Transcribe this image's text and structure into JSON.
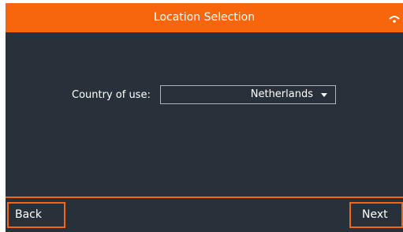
{
  "header": {
    "title": "Location Selection",
    "status_icon": "wifi-icon"
  },
  "main": {
    "country_label": "Country of use:",
    "country_selected": "Netherlands",
    "dropdown_icon": "chevron-down-icon"
  },
  "footer": {
    "back_label": "Back",
    "next_label": "Next"
  },
  "colors": {
    "accent": "#f7660d",
    "background": "#28313a",
    "text": "#ffffff"
  }
}
